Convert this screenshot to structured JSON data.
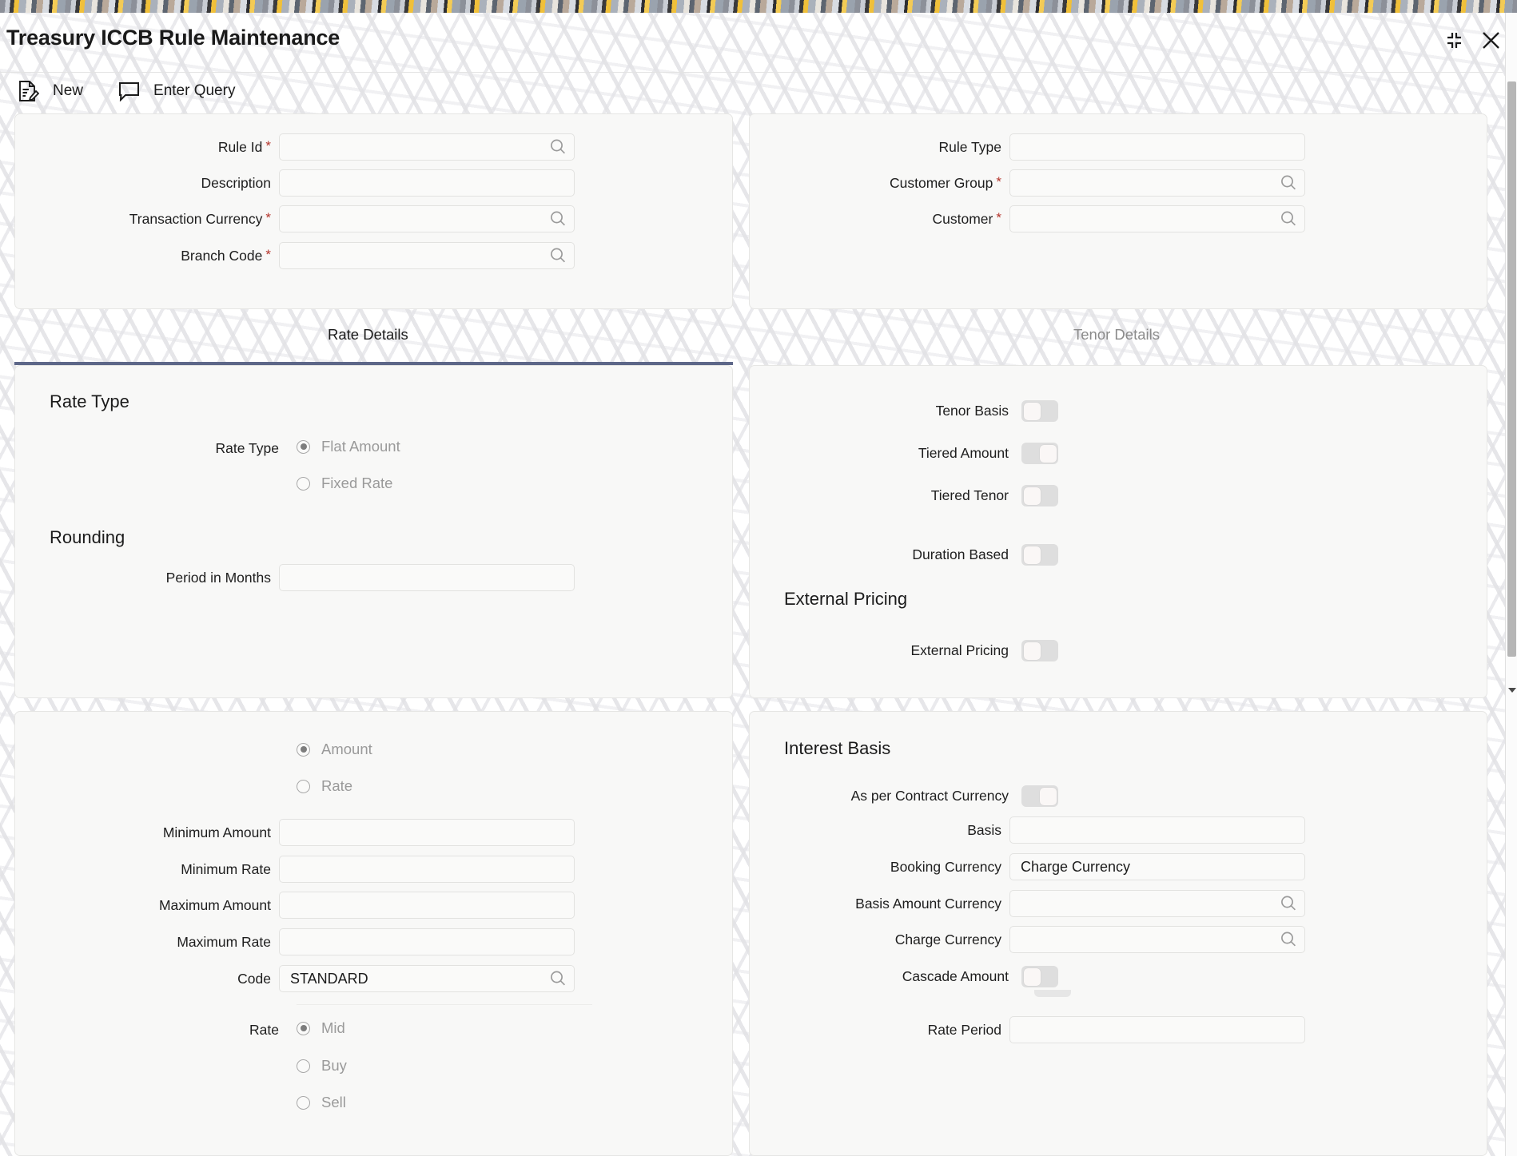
{
  "window": {
    "title": "Treasury ICCB Rule Maintenance",
    "collapse_icon": "collapse-icon",
    "close_icon": "close-icon"
  },
  "toolbar": {
    "items": [
      {
        "label": "New",
        "icon": "new-document-icon"
      },
      {
        "label": "Enter Query",
        "icon": "speech-bubble-icon"
      }
    ]
  },
  "rule_panel": {
    "fields": [
      {
        "label": "Rule Id",
        "required": true,
        "value": "",
        "search": true
      },
      {
        "label": "Description",
        "required": false,
        "value": "",
        "search": false
      },
      {
        "label": "Transaction Currency",
        "required": true,
        "value": "",
        "search": true
      },
      {
        "label": "Branch Code",
        "required": true,
        "value": "",
        "search": true
      }
    ]
  },
  "customer_panel": {
    "fields": [
      {
        "label": "Rule Type",
        "required": false,
        "value": "",
        "search": false
      },
      {
        "label": "Customer Group",
        "required": true,
        "value": "",
        "search": true
      },
      {
        "label": "Customer",
        "required": true,
        "value": "",
        "search": true
      }
    ]
  },
  "tabs": [
    {
      "label": "Rate Details",
      "active": true
    },
    {
      "label": "Tenor Details",
      "active": false
    }
  ],
  "rate_details": {
    "rate_type_heading": "Rate Type",
    "rate_type_label": "Rate Type",
    "rate_type_options": [
      {
        "label": "Flat Amount",
        "selected": true
      },
      {
        "label": "Fixed Rate",
        "selected": false
      }
    ],
    "rounding_heading": "Rounding",
    "period_label": "Period in Months",
    "period_value": ""
  },
  "tenor_details": {
    "toggles": [
      {
        "label": "Tenor Basis",
        "on": false
      },
      {
        "label": "Tiered Amount",
        "on": true
      },
      {
        "label": "Tiered Tenor",
        "on": false
      },
      {
        "label": "Duration Based",
        "on": false
      }
    ],
    "external_pricing_heading": "External Pricing",
    "external_pricing_label": "External Pricing",
    "external_pricing_on": false
  },
  "amount_panel": {
    "amount_rate_options": [
      {
        "label": "Amount",
        "selected": true
      },
      {
        "label": "Rate",
        "selected": false
      }
    ],
    "fields": [
      {
        "label": "Minimum Amount",
        "value": "",
        "search": false
      },
      {
        "label": "Minimum Rate",
        "value": "",
        "search": false
      },
      {
        "label": "Maximum Amount",
        "value": "",
        "search": false
      },
      {
        "label": "Maximum Rate",
        "value": "",
        "search": false
      },
      {
        "label": "Code",
        "value": "STANDARD",
        "search": true
      }
    ],
    "rate_group_label": "Rate",
    "rate_options": [
      {
        "label": "Mid",
        "selected": true
      },
      {
        "label": "Buy",
        "selected": false
      },
      {
        "label": "Sell",
        "selected": false
      }
    ]
  },
  "interest_basis": {
    "heading": "Interest Basis",
    "as_per_contract_currency_label": "As per Contract Currency",
    "as_per_contract_currency_on": true,
    "fields": [
      {
        "label": "Basis",
        "value": "",
        "search": false
      },
      {
        "label": "Booking Currency",
        "value": "Charge Currency",
        "search": false
      },
      {
        "label": "Basis Amount Currency",
        "value": "",
        "search": true
      },
      {
        "label": "Charge Currency",
        "value": "",
        "search": true
      }
    ],
    "cascade_amount_label": "Cascade Amount",
    "cascade_amount_on": false,
    "rate_period_label": "Rate Period",
    "rate_period_value": ""
  },
  "colors": {
    "accent": "#5d6788",
    "required_asterisk": "#b4352c",
    "panel_bg": "#f8f8f7",
    "text": "#1b1b1b",
    "muted_text": "#9a9a9a"
  }
}
